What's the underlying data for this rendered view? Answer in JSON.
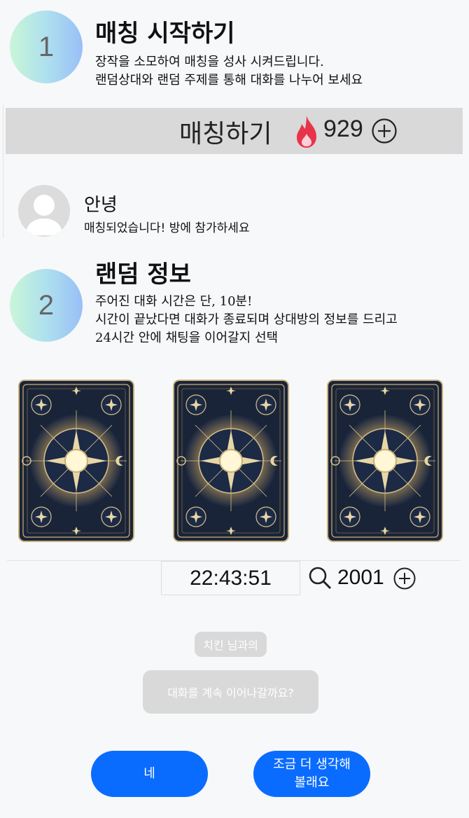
{
  "step1": {
    "number": "1",
    "title": "매칭 시작하기",
    "description": "장작을 소모하여 매칭을 성사 시켜드립니다.\n랜덤상대와 랜덤 주제를 통해 대화를 나누어 보세요"
  },
  "match": {
    "button_label": "매칭하기",
    "fire_icon": "fire-icon",
    "count": "929",
    "add_icon": "plus-circle-icon"
  },
  "profile": {
    "name": "안녕",
    "message": "매칭되었습니다! 방에 참가하세요"
  },
  "step2": {
    "number": "2",
    "title": "랜덤 정보",
    "description": "주어진 대화 시간은 단, 10분!\n시간이 끝났다면 대화가 종료되며 상대방의 정보를 드리고\n24시간 안에 채팅을 이어갈지 선택"
  },
  "cards": [
    "tarot-card-back",
    "tarot-card-back",
    "tarot-card-back"
  ],
  "timer": {
    "value": "22:43:51",
    "search_icon": "search-icon",
    "count": "2001",
    "add_icon": "plus-circle-icon"
  },
  "dialog": {
    "name_chip": "치킨 님과의",
    "question": "대화를 계속 이어나갈까요?",
    "yes_label": "네",
    "later_label": "조금 더 생각해\n볼래요"
  },
  "colors": {
    "primary": "#0a6cff",
    "chip": "#d9d9d9",
    "match_bar": "#d9d9d9",
    "fire": "#e8344a"
  }
}
